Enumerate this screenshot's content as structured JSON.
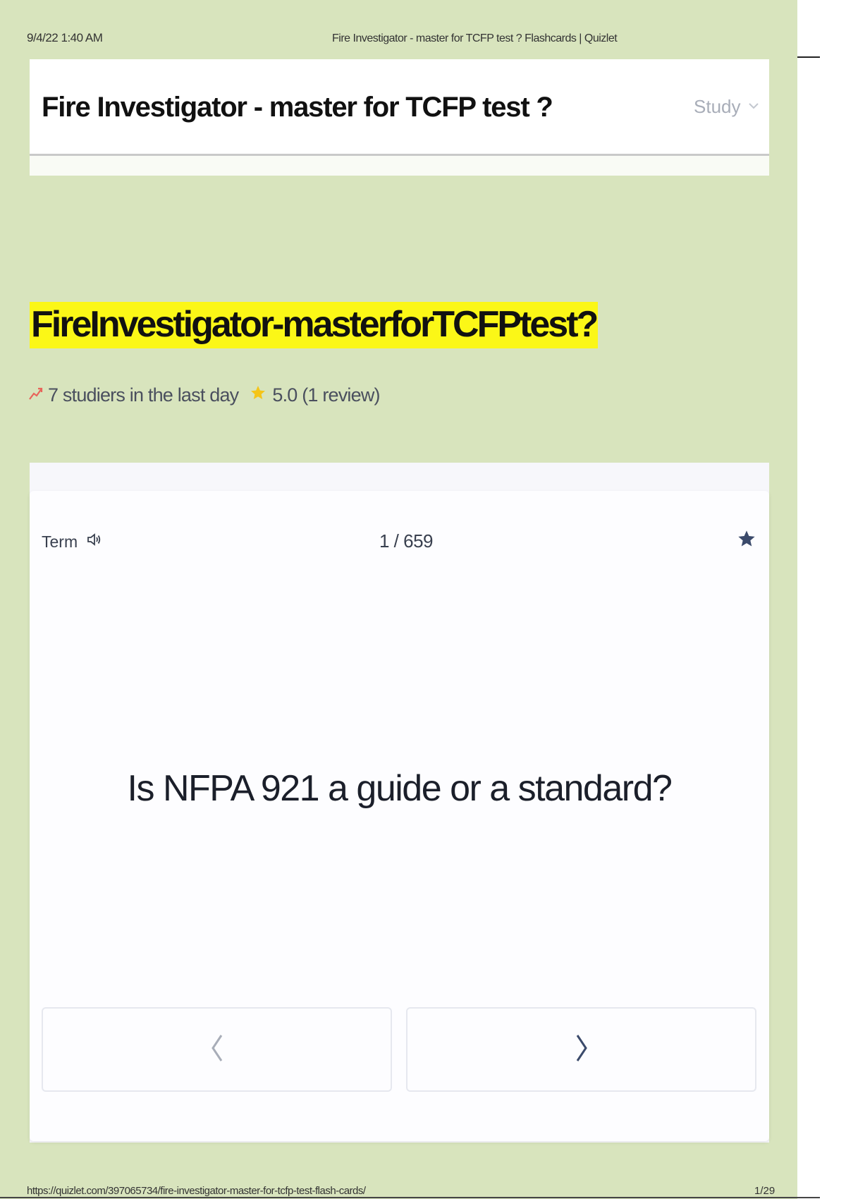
{
  "print_header": {
    "date": "9/4/22 1:40 AM",
    "title": "Fire Investigator - master for TCFP test ? Flashcards | Quizlet"
  },
  "print_footer": {
    "url": "https://quizlet.com/397065734/fire-investigator-master-for-tcfp-test-flash-cards/",
    "page": "1/29"
  },
  "header": {
    "title": "Fire Investigator - master for TCFP test ?",
    "study_label": "Study",
    "study_icon": "chevron-down-icon"
  },
  "main": {
    "heading": "FireInvestigator-masterforTCFPtest?",
    "studiers_text": "7 studiers in the last day",
    "rating_text": "5.0 (1 review)"
  },
  "flashcard": {
    "side_label": "Term",
    "counter": "1 / 659",
    "question": "Is NFPA 921 a guide or a standard?"
  },
  "colors": {
    "page_background": "#d8e4bd",
    "highlight": "#fbf717",
    "rating_star": "#f5c518",
    "trend": "#e8645a",
    "card_icon": "#3b4a6b"
  }
}
